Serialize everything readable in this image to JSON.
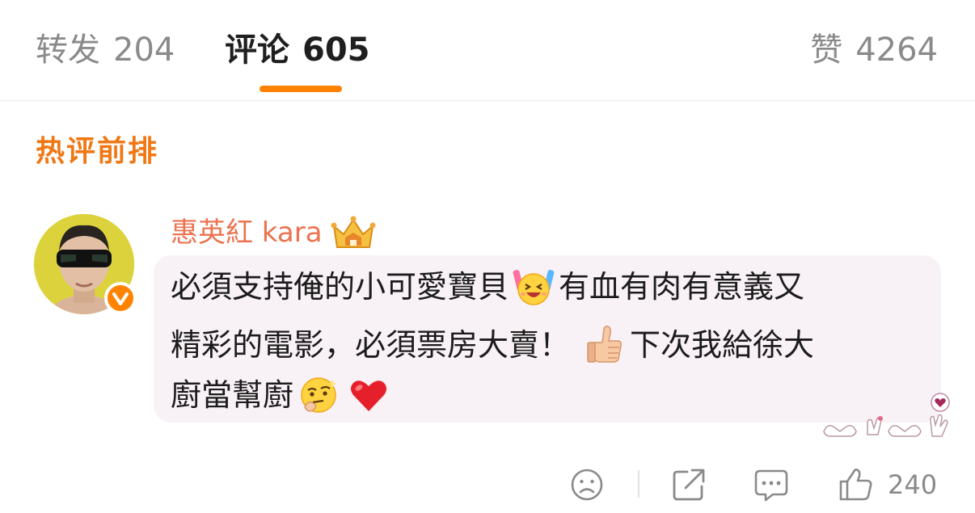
{
  "tabs": {
    "repost": {
      "label": "转发",
      "count": "204"
    },
    "comments": {
      "label": "评论",
      "count": "605"
    },
    "likes": {
      "label": "赞",
      "count": "4264"
    }
  },
  "section_title": "热评前排",
  "comment": {
    "username": "惠英紅 kara",
    "user_badges": [
      "vip-crown-icon",
      "verified-badge"
    ],
    "text_line_1_a": "必須支持俺的小可愛寶貝",
    "text_line_1_b": "有血有肉有意義又",
    "text_line_2_a": "精彩的電影，必須票房大賣！",
    "text_line_2_b": "下次我給徐大",
    "text_line_3": "廚當幫廚",
    "emojis": [
      "cheering-emoji-icon",
      "thumbs-up-emoji-icon",
      "thinking-emoji-icon",
      "red-heart-emoji-icon"
    ],
    "like_count": "240"
  },
  "actions": [
    "dislike-icon",
    "share-icon",
    "reply-icon",
    "like-icon"
  ],
  "colors": {
    "accent": "#ff8200",
    "section_title": "#f07814",
    "username": "#eb7350",
    "bubble_background": "#f8f1f6",
    "muted_text": "#8a8a8a"
  }
}
